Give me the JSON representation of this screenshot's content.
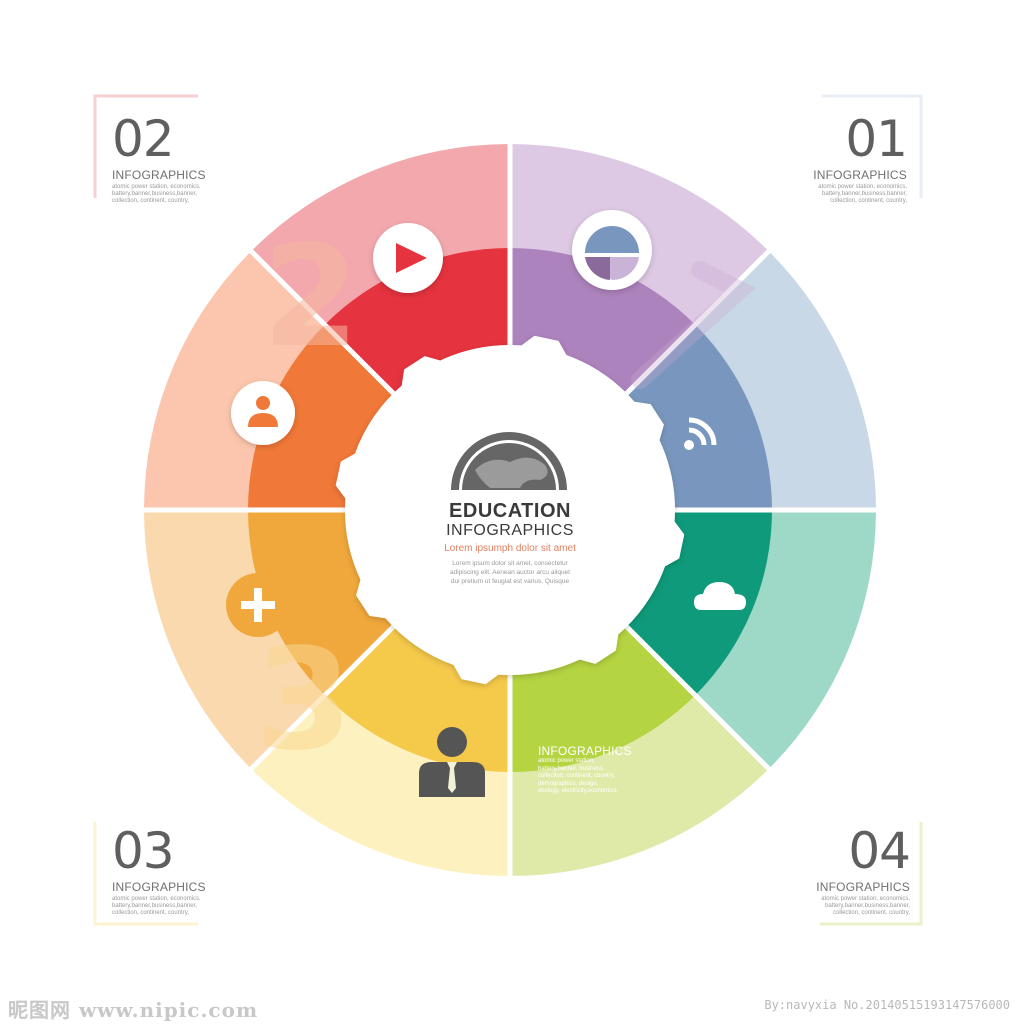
{
  "corners": [
    {
      "number": "02",
      "label": "INFOGRAPHICS",
      "desc": [
        "atomic power station, economics,",
        "battery,banner,business,banner,",
        "collection, continent,  country,"
      ]
    },
    {
      "number": "01",
      "label": "INFOGRAPHICS",
      "desc": [
        "atomic power station, economics,",
        "battery,banner,business,banner,",
        "collection, continent,  country,"
      ]
    },
    {
      "number": "03",
      "label": "INFOGRAPHICS",
      "desc": [
        "atomic power station, economics,",
        "battery,banner,business,banner,",
        "collection, continent,  country,"
      ]
    },
    {
      "number": "04",
      "label": "INFOGRAPHICS",
      "desc": [
        "atomic power station, economics,",
        "battery,banner,business,banner,",
        "collection, continent,  country,"
      ]
    }
  ],
  "center": {
    "title": "EDUCATION",
    "subtitle": "INFOGRAPHICS",
    "tagline": "Lorem ipsumph dolor sit amet",
    "desc": [
      "Lorem ipsum dolor sit amet, consectetur",
      "adipiscing elit. Aenean auctor arcu aliquet",
      "dui pretium ut feugiat est varius. Quisque"
    ]
  },
  "green_segment": {
    "title": "INFOGRAPHICS",
    "desc": [
      "atomic power station,",
      "battery,banner, business,",
      "collection, continent, country,",
      "demographics, design,",
      "ecology, electricity,economics,"
    ]
  },
  "footer": {
    "left": "昵图网 www.nipic.com",
    "right": "By:navyxia  No.20140515193147576000"
  },
  "segments": [
    {
      "name": "segment-red",
      "outer": "#f3a8ad",
      "inner": "#e5333f",
      "icon": "play-icon"
    },
    {
      "name": "segment-purple",
      "outer": "#ddc9e4",
      "inner": "#ad83bd",
      "icon": "pie-chart-icon"
    },
    {
      "name": "segment-blue",
      "outer": "#c9d8e6",
      "inner": "#7997be",
      "icon": "wifi-icon"
    },
    {
      "name": "segment-teal",
      "outer": "#9ed8c7",
      "inner": "#0f9b7b",
      "icon": "cloud-icon"
    },
    {
      "name": "segment-green",
      "outer": "#dfeaa8",
      "inner": "#b5d441",
      "icon": ""
    },
    {
      "name": "segment-yellow",
      "outer": "#fdf1bf",
      "inner": "#f5c94a",
      "icon": "businessman-icon"
    },
    {
      "name": "segment-amber",
      "outer": "#f9d9ad",
      "inner": "#f0a83c",
      "icon": "plus-icon"
    },
    {
      "name": "segment-orange",
      "outer": "#fbc6ad",
      "inner": "#f07838",
      "icon": "user-icon"
    }
  ]
}
